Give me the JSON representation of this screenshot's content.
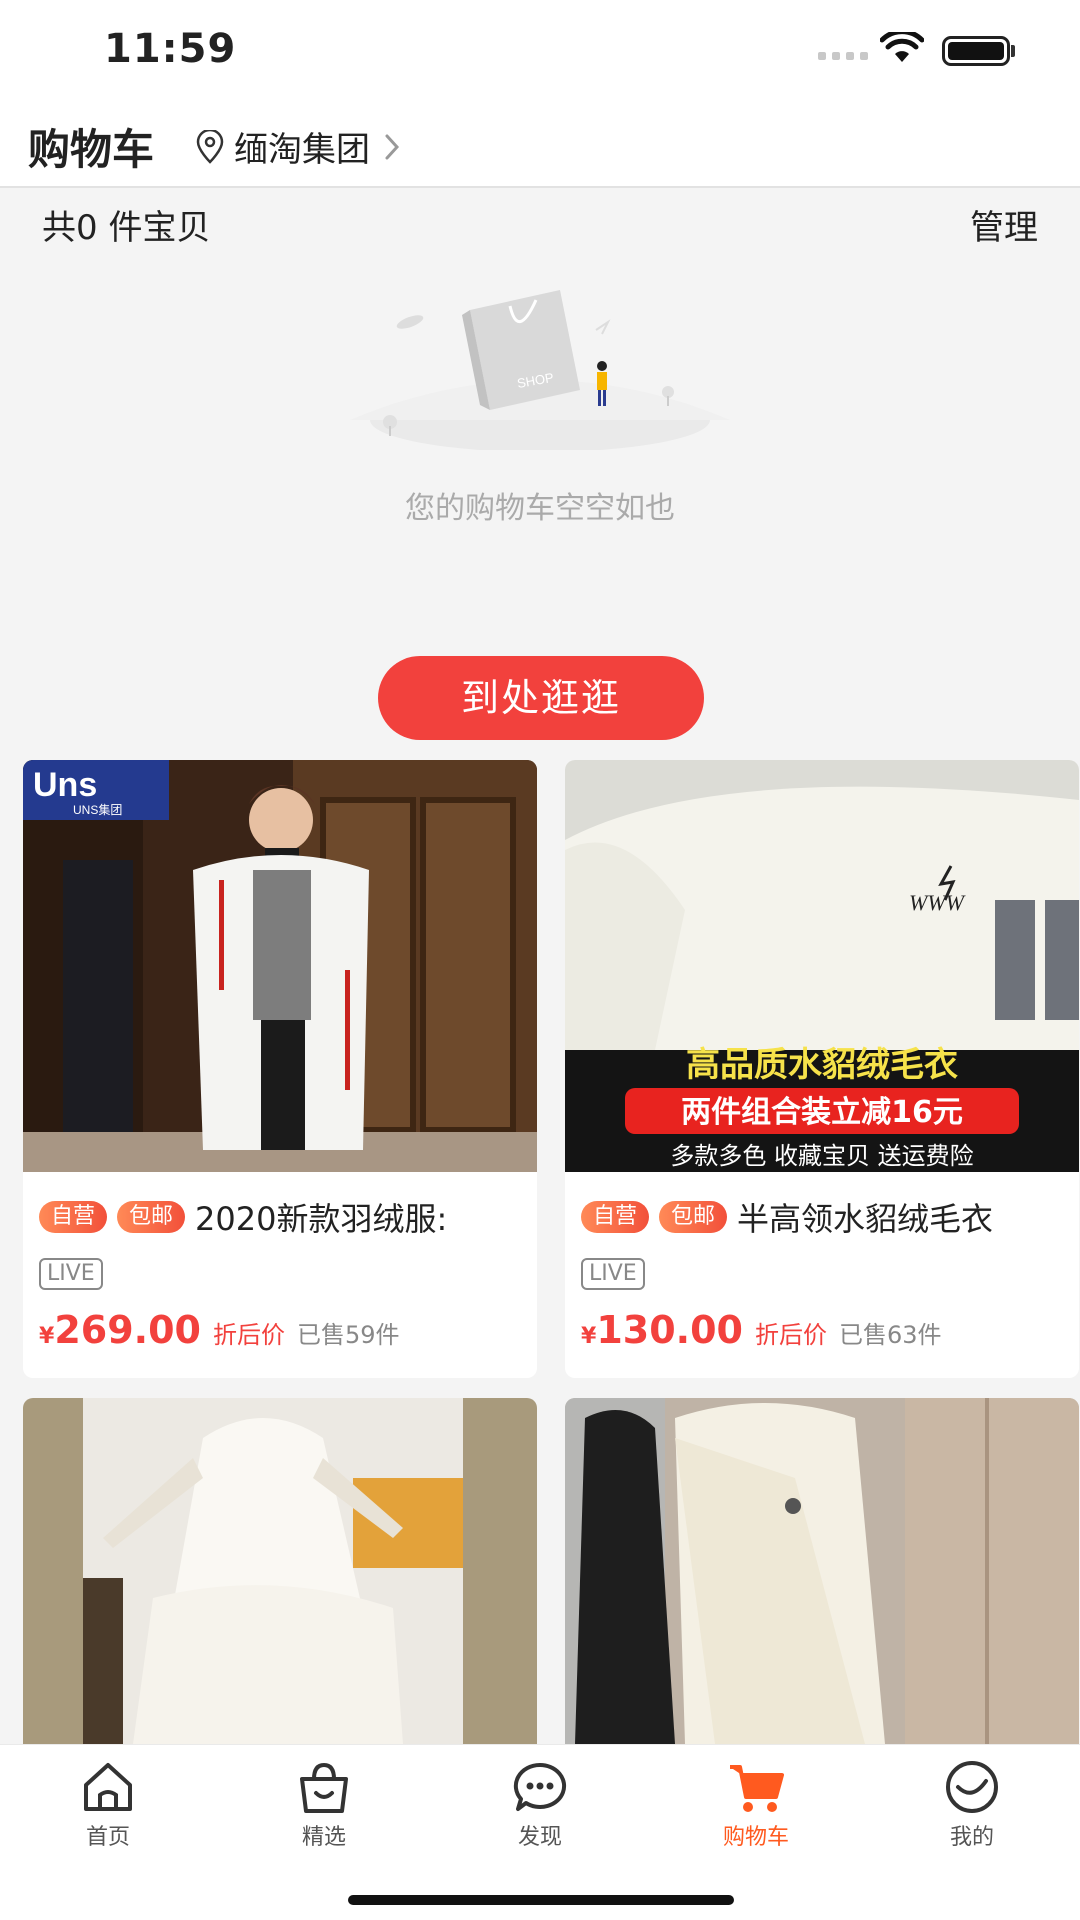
{
  "status_bar": {
    "time": "11:59"
  },
  "header": {
    "title": "购物车",
    "location": "缅淘集团"
  },
  "cart": {
    "count_label": "共0 件宝贝",
    "manage_label": "管理",
    "empty_text": "您的购物车空空如也",
    "browse_label": "到处逛逛",
    "illustration_text": "SHOP"
  },
  "products": [
    {
      "tags": [
        "自营",
        "包邮"
      ],
      "title": "2020新款羽绒服:",
      "live": "LIVE",
      "currency": "¥",
      "price": "269.00",
      "discount_label": "折后价",
      "sold": "已售59件",
      "image_brand": "Uns",
      "image_brand_sub": "UNS集团"
    },
    {
      "tags": [
        "自营",
        "包邮"
      ],
      "title": "半高领水貂绒毛衣",
      "live": "LIVE",
      "currency": "¥",
      "price": "130.00",
      "discount_label": "折后价",
      "sold": "已售63件",
      "image_caption_1": "高品质水貂绒毛衣",
      "image_caption_2": "两件组合装立减16元",
      "image_caption_3": "多款多色 收藏宝贝 送运费险",
      "image_logo": "WWW"
    },
    {
      "image_desc": "white lace dress"
    },
    {
      "image_desc": "white one-shoulder dress"
    }
  ],
  "tabbar": {
    "items": [
      {
        "label": "首页",
        "icon": "home-icon"
      },
      {
        "label": "精选",
        "icon": "shopping-bag-icon"
      },
      {
        "label": "发现",
        "icon": "chat-bubble-icon"
      },
      {
        "label": "购物车",
        "icon": "cart-icon",
        "active": true
      },
      {
        "label": "我的",
        "icon": "smile-icon"
      }
    ]
  },
  "colors": {
    "accent": "#f2413d",
    "tab_active": "#ff5a1f"
  }
}
